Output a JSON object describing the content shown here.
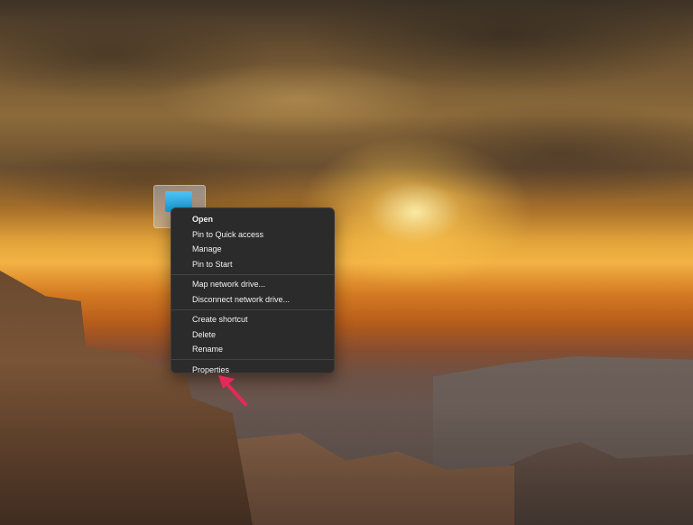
{
  "desktop": {
    "wallpaper": "canyon-sunset",
    "icon": {
      "name": "this-pc-icon"
    }
  },
  "context_menu": {
    "groups": [
      [
        {
          "label": "Open",
          "bold": true
        },
        {
          "label": "Pin to Quick access"
        },
        {
          "label": "Manage"
        },
        {
          "label": "Pin to Start"
        }
      ],
      [
        {
          "label": "Map network drive..."
        },
        {
          "label": "Disconnect network drive..."
        }
      ],
      [
        {
          "label": "Create shortcut"
        },
        {
          "label": "Delete"
        },
        {
          "label": "Rename"
        }
      ],
      [
        {
          "label": "Properties"
        }
      ]
    ]
  },
  "annotation": {
    "color": "#e6285a",
    "points_to": "Properties"
  }
}
